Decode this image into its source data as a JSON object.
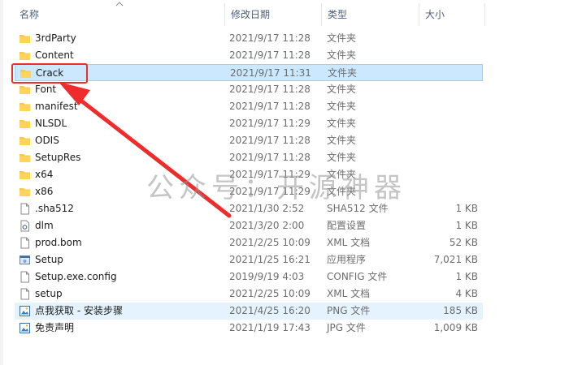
{
  "header": {
    "name": "名称",
    "date": "修改日期",
    "type": "类型",
    "size": "大小"
  },
  "files": [
    {
      "name": "3rdParty",
      "date": "2021/9/17 11:28",
      "type": "文件夹",
      "size": "",
      "icon": "folder-icon",
      "state": ""
    },
    {
      "name": "Content",
      "date": "2021/9/17 11:28",
      "type": "文件夹",
      "size": "",
      "icon": "folder-icon",
      "state": ""
    },
    {
      "name": "Crack",
      "date": "2021/9/17 11:31",
      "type": "文件夹",
      "size": "",
      "icon": "folder-icon",
      "state": "selected"
    },
    {
      "name": "Font",
      "date": "2021/9/17 11:28",
      "type": "文件夹",
      "size": "",
      "icon": "folder-icon",
      "state": ""
    },
    {
      "name": "manifest",
      "date": "2021/9/17 11:28",
      "type": "文件夹",
      "size": "",
      "icon": "folder-icon",
      "state": ""
    },
    {
      "name": "NLSDL",
      "date": "2021/9/17 11:29",
      "type": "文件夹",
      "size": "",
      "icon": "folder-icon",
      "state": ""
    },
    {
      "name": "ODIS",
      "date": "2021/9/17 11:28",
      "type": "文件夹",
      "size": "",
      "icon": "folder-icon",
      "state": ""
    },
    {
      "name": "SetupRes",
      "date": "2021/9/17 11:28",
      "type": "文件夹",
      "size": "",
      "icon": "folder-icon",
      "state": ""
    },
    {
      "name": "x64",
      "date": "2021/9/17 11:29",
      "type": "文件夹",
      "size": "",
      "icon": "folder-icon",
      "state": ""
    },
    {
      "name": "x86",
      "date": "2021/9/17 11:29",
      "type": "文件夹",
      "size": "",
      "icon": "folder-icon",
      "state": ""
    },
    {
      "name": ".sha512",
      "date": "2021/1/30 2:52",
      "type": "SHA512 文件",
      "size": "1 KB",
      "icon": "file-icon",
      "state": ""
    },
    {
      "name": "dlm",
      "date": "2021/3/20 2:00",
      "type": "配置设置",
      "size": "1 KB",
      "icon": "config-file-icon",
      "state": ""
    },
    {
      "name": "prod.bom",
      "date": "2021/2/25 10:09",
      "type": "XML 文档",
      "size": "52 KB",
      "icon": "file-icon",
      "state": ""
    },
    {
      "name": "Setup",
      "date": "2021/1/25 16:21",
      "type": "应用程序",
      "size": "7,021 KB",
      "icon": "application-icon",
      "state": ""
    },
    {
      "name": "Setup.exe.config",
      "date": "2019/9/19 4:03",
      "type": "CONFIG 文件",
      "size": "1 KB",
      "icon": "file-icon",
      "state": ""
    },
    {
      "name": "setup",
      "date": "2021/2/25 10:09",
      "type": "XML 文档",
      "size": "4 KB",
      "icon": "file-icon",
      "state": ""
    },
    {
      "name": "点我获取 - 安装步骤",
      "date": "2021/4/25 16:20",
      "type": "PNG 文件",
      "size": "185 KB",
      "icon": "image-file-icon",
      "state": "hover"
    },
    {
      "name": "免责声明",
      "date": "2021/1/19 17:43",
      "type": "JPG 文件",
      "size": "1,009 KB",
      "icon": "image-file-icon",
      "state": ""
    }
  ],
  "watermark": "公众号：开源神器",
  "colors": {
    "selection_bg": "#cce8ff",
    "selection_border": "#99d1ff",
    "hover_bg": "#e5f3ff",
    "annotation_red": "#ef2b2b",
    "folder_yellow": "#ffd45a"
  }
}
